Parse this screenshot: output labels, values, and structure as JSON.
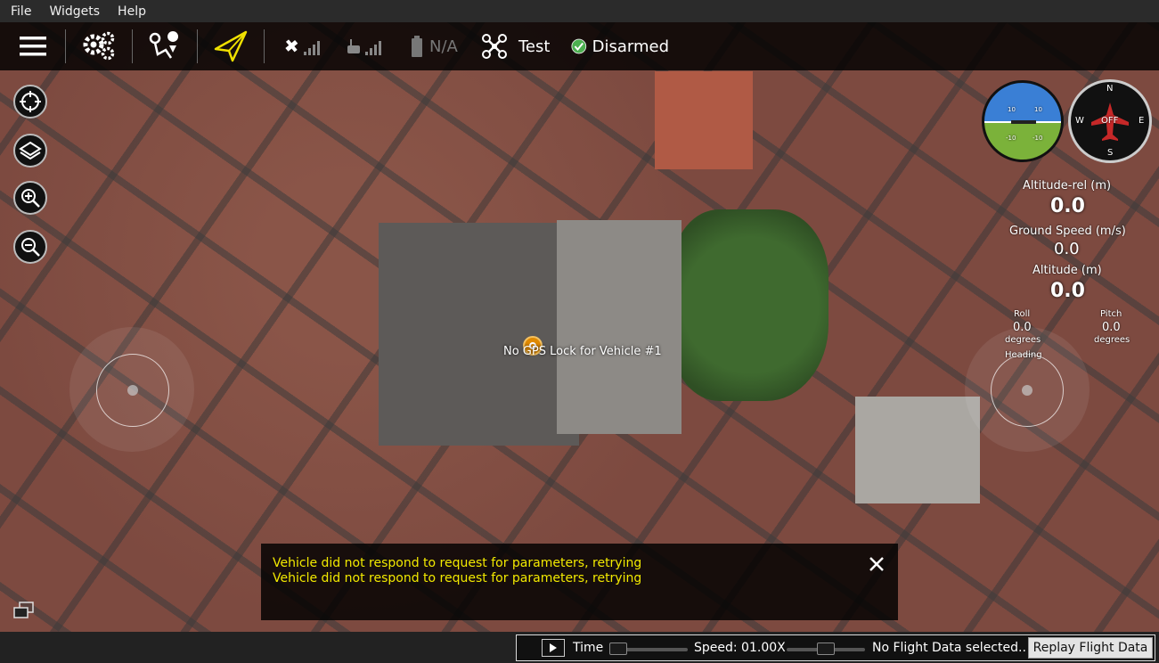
{
  "menubar": {
    "items": [
      "File",
      "Widgets",
      "Help"
    ]
  },
  "toolbar": {
    "battery_text": "N/A",
    "vehicle_name": "Test",
    "arm_status": "Disarmed",
    "arm_status_color": "#4caf50",
    "plan_icon_color": "#f0e000"
  },
  "map": {
    "home_marker_label": "No GPS Lock for Vehicle #1"
  },
  "instruments": {
    "attitude_labels": [
      "10",
      "10",
      "-10",
      "-10"
    ],
    "compass_letters": {
      "north": "N",
      "south": "S",
      "east": "E",
      "west": "W"
    },
    "compass_center": "OFF",
    "altitude_rel_label": "Altitude-rel (m)",
    "altitude_rel_value": "0.0",
    "ground_speed_label": "Ground Speed (m/s)",
    "ground_speed_value": "0.0",
    "altitude_label": "Altitude (m)",
    "altitude_value": "0.0",
    "roll_label": "Roll",
    "roll_value": "0.0",
    "roll_unit": "degrees",
    "pitch_label": "Pitch",
    "pitch_value": "0.0",
    "pitch_unit": "degrees",
    "heading_label": "Heading"
  },
  "messages": {
    "lines": [
      "Vehicle did not respond to request for parameters, retrying",
      "Vehicle did not respond to request for parameters, retrying"
    ],
    "text_color": "#f2e900"
  },
  "replay": {
    "time_label": "Time",
    "speed_label": "Speed: 01.00X",
    "status_text": "No Flight Data selected..",
    "replay_button_label": "Replay Flight Data"
  }
}
